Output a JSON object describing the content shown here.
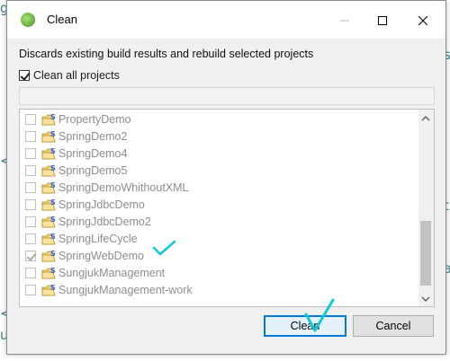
{
  "window": {
    "title": "Clean",
    "controls": [
      "minimize-icon",
      "maximize-icon",
      "close-icon"
    ]
  },
  "description": "Discards existing build results and rebuild selected projects",
  "clean_all": {
    "label": "Clean all projects",
    "checked": true
  },
  "projects": [
    {
      "name": "PropertyDemo",
      "checked": false
    },
    {
      "name": "SpringDemo2",
      "checked": false
    },
    {
      "name": "SpringDemo4",
      "checked": false
    },
    {
      "name": "SpringDemo5",
      "checked": false
    },
    {
      "name": "SpringDemoWhithoutXML",
      "checked": false
    },
    {
      "name": "SpringJdbcDemo",
      "checked": false
    },
    {
      "name": "SpringJdbcDemo2",
      "checked": false
    },
    {
      "name": "SpringLifeCycle",
      "checked": false
    },
    {
      "name": "SpringWebDemo",
      "checked": true
    },
    {
      "name": "SungjukManagement",
      "checked": false
    },
    {
      "name": "SungjukManagement-work",
      "checked": false
    }
  ],
  "buttons": {
    "clean": "Clean",
    "cancel": "Cancel"
  },
  "colors": {
    "annotation": "#10c8d8",
    "default_button_border": "#0078d7",
    "disabled_text": "#8d8d8d"
  }
}
